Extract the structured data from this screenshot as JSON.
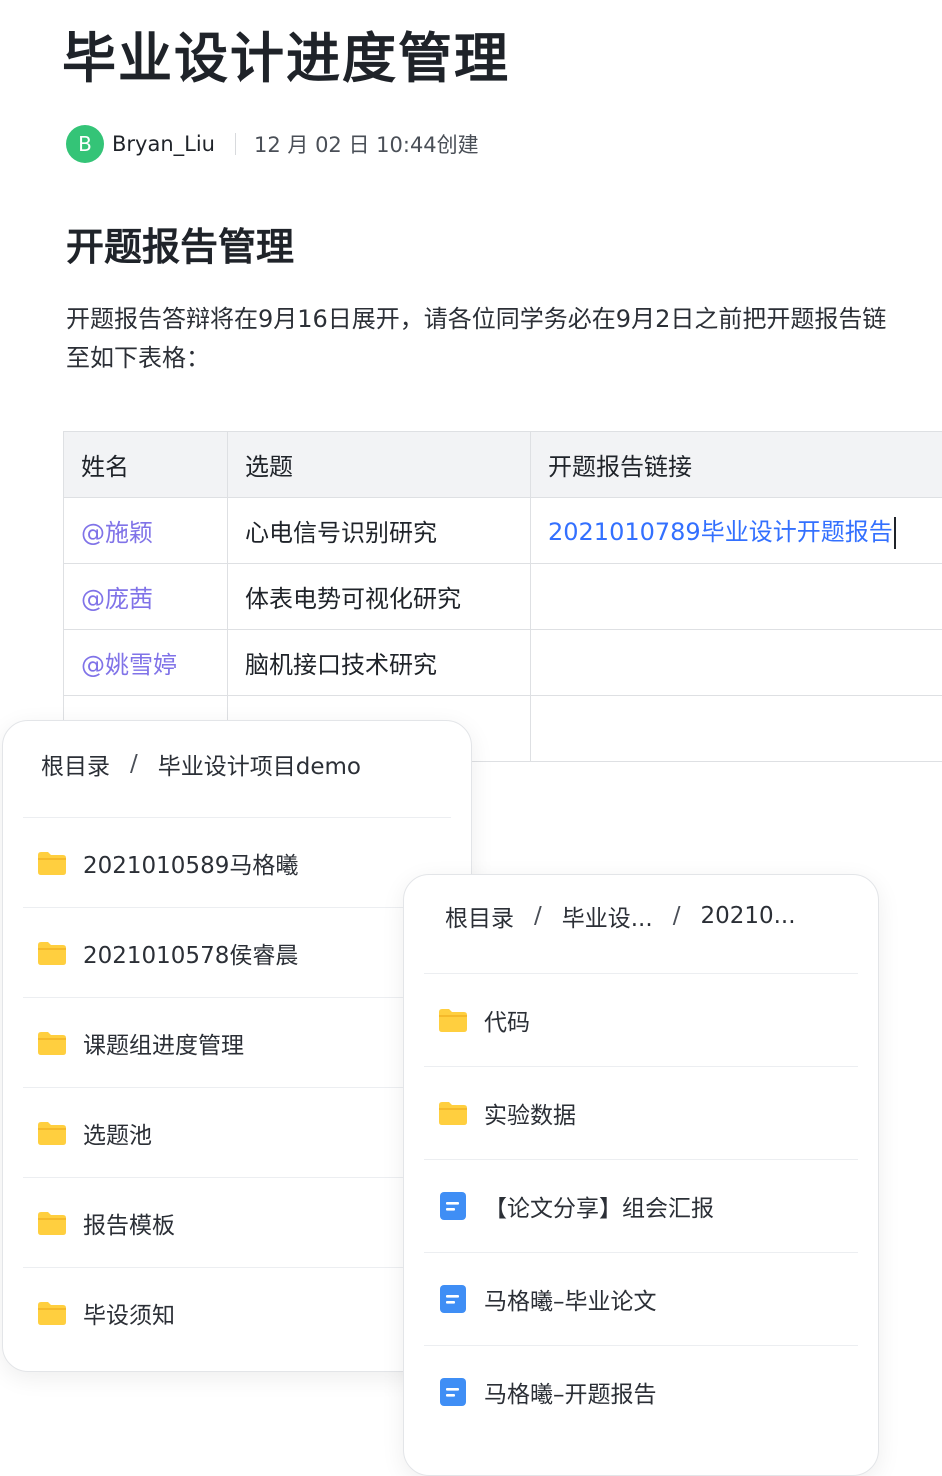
{
  "doc": {
    "title": "毕业设计进度管理",
    "author_initial": "B",
    "author_name": "Bryan_Liu",
    "created": "12 月 02 日 10:44创建",
    "section_title": "开题报告管理",
    "paragraph_line1": "开题报告答辩将在9月16日展开，请各位同学务必在9月2日之前把开题报告链",
    "paragraph_line2": "至如下表格："
  },
  "table": {
    "headers": [
      "姓名",
      "选题",
      "开题报告链接"
    ],
    "rows": [
      {
        "name": "@施颖",
        "topic": "心电信号识别研究",
        "link": "2021010789毕业设计开题报告"
      },
      {
        "name": "@庞茜",
        "topic": "体表电势可视化研究",
        "link": ""
      },
      {
        "name": "@姚雪婷",
        "topic": "脑机接口技术研究",
        "link": ""
      },
      {
        "name": "",
        "topic": "",
        "link": ""
      }
    ]
  },
  "panel1": {
    "breadcrumb": [
      "根目录",
      "毕业设计项目demo"
    ],
    "items": [
      {
        "label": "2021010589马格曦",
        "icon": "folder-icon"
      },
      {
        "label": "2021010578侯睿晨",
        "icon": "folder-icon"
      },
      {
        "label": "课题组进度管理",
        "icon": "folder-icon"
      },
      {
        "label": "选题池",
        "icon": "folder-icon"
      },
      {
        "label": "报告模板",
        "icon": "folder-icon"
      },
      {
        "label": "毕设须知",
        "icon": "folder-icon"
      }
    ]
  },
  "panel2": {
    "breadcrumb": [
      "根目录",
      "毕业设...",
      "20210..."
    ],
    "items": [
      {
        "label": "代码",
        "icon": "folder-icon"
      },
      {
        "label": "实验数据",
        "icon": "folder-icon"
      },
      {
        "label": "【论文分享】组会汇报",
        "icon": "doc-icon"
      },
      {
        "label": "马格曦–毕业论文",
        "icon": "doc-icon"
      },
      {
        "label": "马格曦–开题报告",
        "icon": "doc-icon"
      }
    ]
  },
  "colors": {
    "avatar": "#34c477",
    "mention": "#8073e8",
    "link": "#3370ff",
    "folder": "#ffcf3f",
    "doc": "#3f8ef5"
  }
}
